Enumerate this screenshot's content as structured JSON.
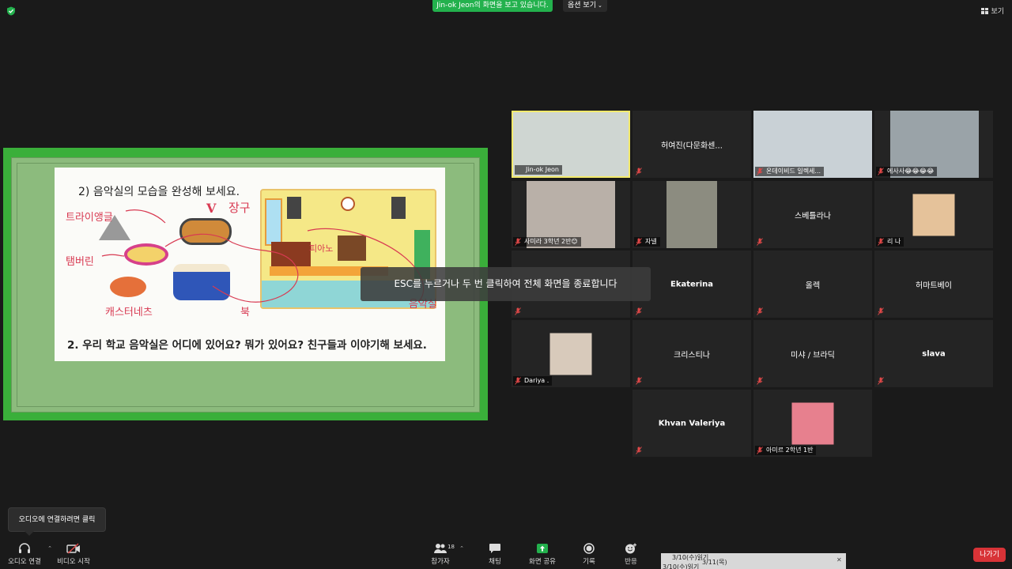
{
  "top": {
    "share_banner": "Jin-ok Jeon의 화면을 보고 있습니다.",
    "view_options": "옵션 보기",
    "layout_label": "보기"
  },
  "worksheet": {
    "title": "2) 음악실의 모습을 완성해 보세요.",
    "question": "2. 우리 학교 음악실은 어디에 있어요? 뭐가 있어요? 친구들과 이야기해 보세요.",
    "handwriting": {
      "triangle": "트라이앵글",
      "tambourine": "탬버린",
      "castanets": "캐스터네츠",
      "janggu": "장구",
      "check": "V",
      "drum": "북",
      "piano": "피아노",
      "music_room": "음악실"
    }
  },
  "toast": "ESC를 누르거나 두 번 클릭하여 전체 화면을 종료합니다",
  "participants": [
    {
      "name": "Jin-ok Jeon",
      "kind": "video",
      "active": true
    },
    {
      "name": "허여진(다문화센...",
      "kind": "name"
    },
    {
      "name": "온데이비드 일렉세...",
      "kind": "video"
    },
    {
      "name": "에사사😂😂😂😂",
      "kind": "video"
    },
    {
      "name": "사미라 3학년 2반😊",
      "kind": "video"
    },
    {
      "name": "자넬",
      "kind": "video"
    },
    {
      "name": "스베틀라나",
      "kind": "name"
    },
    {
      "name": "리 나",
      "kind": "avatar"
    },
    {
      "name": "",
      "kind": "empty"
    },
    {
      "name": "Ekaterina",
      "kind": "name",
      "bold": true
    },
    {
      "name": "올렉",
      "kind": "name"
    },
    {
      "name": "허마트베이",
      "kind": "name"
    },
    {
      "name": "Dariya .",
      "kind": "avatar"
    },
    {
      "name": "크리스티나",
      "kind": "name"
    },
    {
      "name": "미샤 / 브라딕",
      "kind": "name"
    },
    {
      "name": "slava",
      "kind": "name",
      "bold": true
    },
    {
      "name": "Khvan Valeriya",
      "kind": "name",
      "bold": true
    },
    {
      "name": "아미르 2학년 1반",
      "kind": "avatar"
    }
  ],
  "audio_tip": "오디오에 연결하려면 클릭",
  "toolbar": {
    "audio": "오디오 연결",
    "video": "비디오 시작",
    "participants": "참가자",
    "participant_count": "18",
    "chat": "채팅",
    "share": "화면 공유",
    "record": "기록",
    "reactions": "반응",
    "leave": "나가기"
  },
  "taskbar_peek": {
    "item1": "3/10(수)읽기",
    "item2": "3/11(목)",
    "item3": "3/10(수)읽기"
  },
  "colors": {
    "share_green": "#23b14d",
    "active_border": "#f3ea6c",
    "leave_red": "#d83337",
    "slide_green": "#3aaf3a"
  }
}
